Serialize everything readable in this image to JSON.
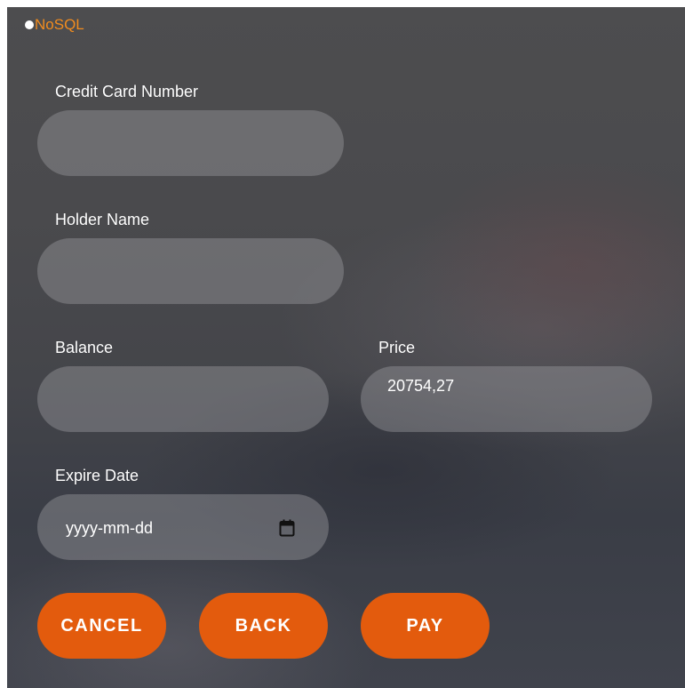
{
  "brand": {
    "name": "NoSQL",
    "accent_color": "#f28c1e"
  },
  "form": {
    "card_number": {
      "label": "Credit Card Number",
      "value": ""
    },
    "holder_name": {
      "label": "Holder Name",
      "value": ""
    },
    "balance": {
      "label": "Balance",
      "value": ""
    },
    "price": {
      "label": "Price",
      "value": "20754,27"
    },
    "expire_date": {
      "label": "Expire Date",
      "placeholder": "yyyy-mm-dd",
      "icon": "calendar-icon"
    }
  },
  "actions": {
    "cancel_label": "CANCEL",
    "back_label": "BACK",
    "pay_label": "PAY",
    "button_color": "#e35b0d"
  }
}
